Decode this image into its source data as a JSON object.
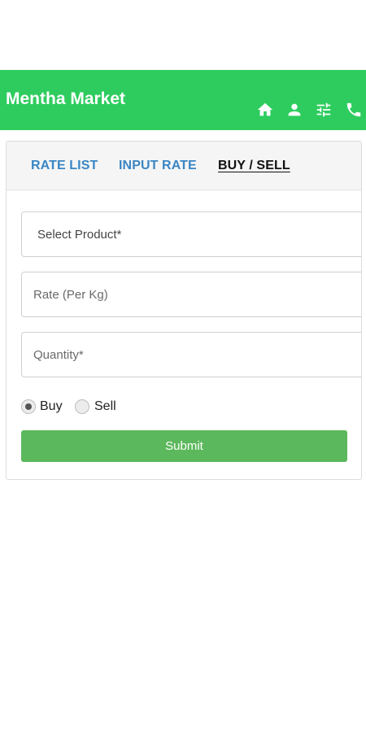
{
  "header": {
    "title": "Mentha Market",
    "background": "#2ecc5e",
    "icons": [
      "home-icon",
      "person-icon",
      "tune-icon",
      "phone-icon"
    ]
  },
  "tabs": [
    {
      "label": "RATE LIST",
      "active": false
    },
    {
      "label": "INPUT RATE",
      "active": false
    },
    {
      "label": "BUY / SELL",
      "active": true
    }
  ],
  "form": {
    "product_placeholder": "Select Product*",
    "rate_placeholder": "Rate (Per Kg)",
    "quantity_placeholder": "Quantity*",
    "radio_buy": "Buy",
    "radio_sell": "Sell",
    "selected": "Buy",
    "submit_label": "Submit",
    "submit_color": "#5cb85c"
  }
}
